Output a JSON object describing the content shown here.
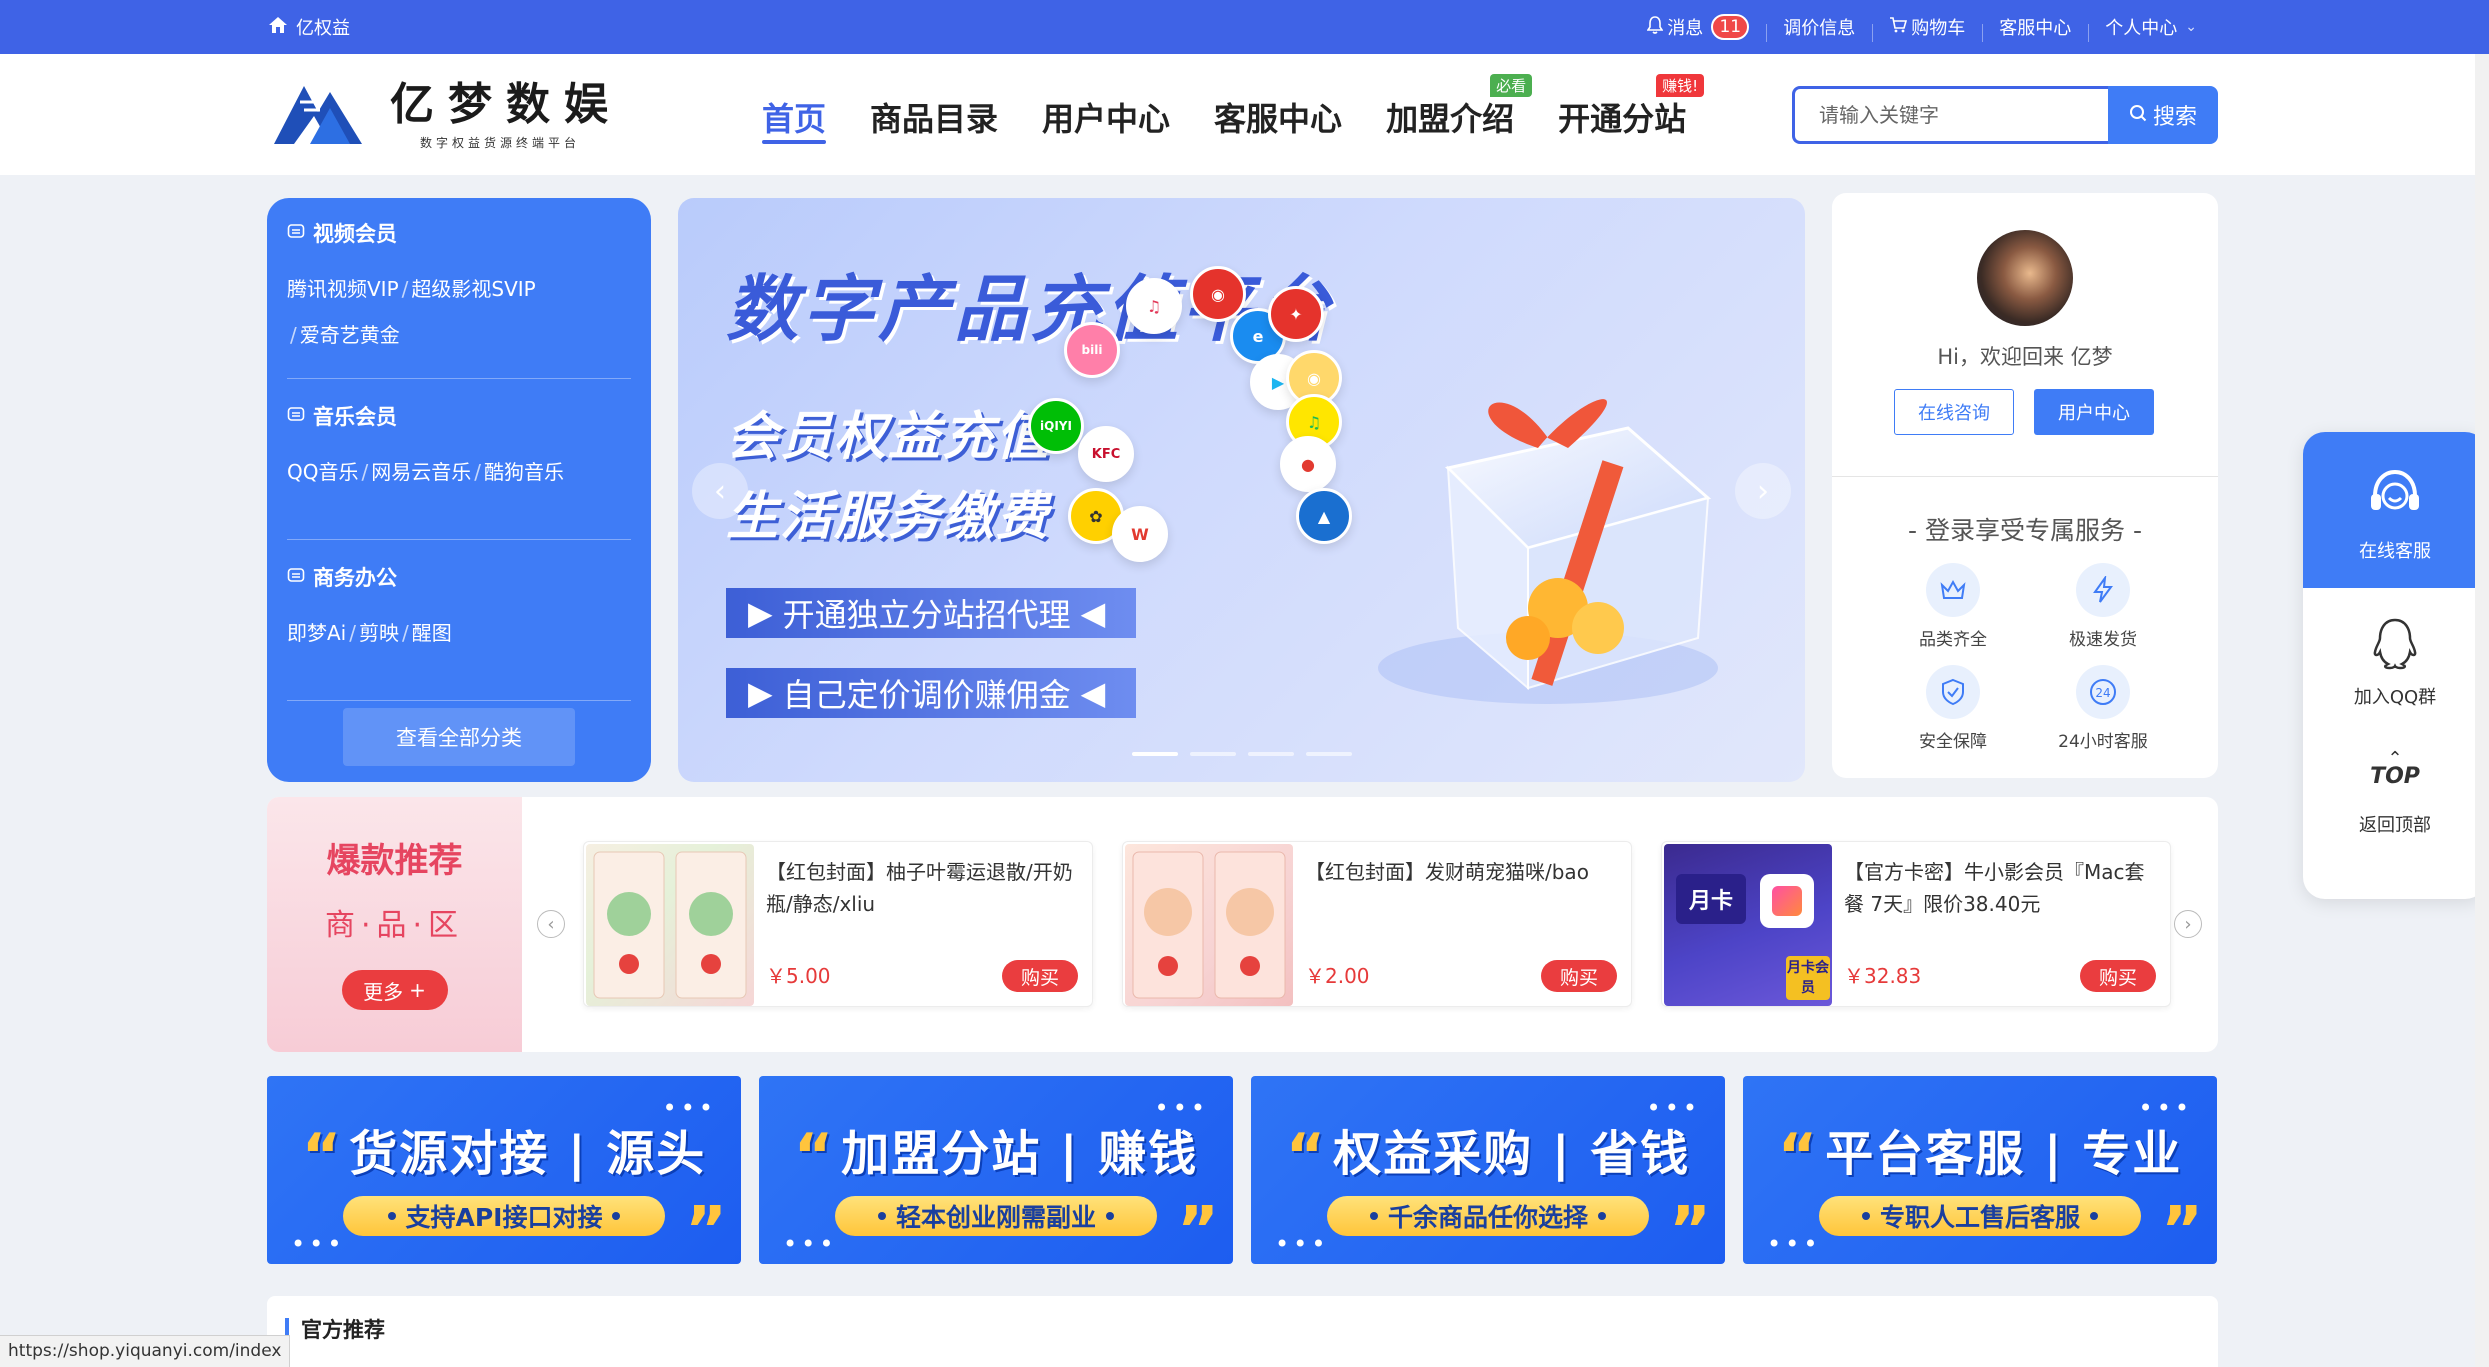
{
  "topbar": {
    "site_name": "亿权益",
    "messages_label": "消息",
    "messages_count": "11",
    "price_info": "调价信息",
    "cart": "购物车",
    "service": "客服中心",
    "personal": "个人中心"
  },
  "header": {
    "logo_name": "亿梦数娱",
    "logo_tagline": "数字权益货源终端平台",
    "nav": [
      {
        "label": "首页"
      },
      {
        "label": "商品目录"
      },
      {
        "label": "用户中心"
      },
      {
        "label": "客服中心"
      },
      {
        "label": "加盟介绍",
        "tag": "必看"
      },
      {
        "label": "开通分站",
        "tag": "赚钱!"
      }
    ],
    "search_placeholder": "请输入关键字",
    "search_button": "搜索"
  },
  "categories": {
    "blocks": [
      {
        "title": "视频会员",
        "links": [
          "腾讯视频VIP",
          "超级影视SVIP",
          "爱奇艺黄金"
        ]
      },
      {
        "title": "音乐会员",
        "links": [
          "QQ音乐",
          "网易云音乐",
          "酷狗音乐"
        ]
      },
      {
        "title": "商务办公",
        "links": [
          "即梦Ai",
          "剪映",
          "醒图"
        ]
      }
    ],
    "view_all": "查看全部分类"
  },
  "banner": {
    "title": "数字产品充值平台",
    "line1": "会员权益充值",
    "line2": "生活服务缴费",
    "pill1": "开通独立分站招代理",
    "pill2": "自己定价调价赚佣金",
    "slide_index": 1,
    "slide_count": 4,
    "icons": [
      "bilibili",
      "QQ音乐",
      "网易云",
      "饿了么",
      "腾讯视频",
      "爱奇艺",
      "KFC",
      "WPS",
      "优酷",
      "喜马拉雅",
      "美团",
      "QQ"
    ]
  },
  "user": {
    "greeting": "Hi，欢迎回来 亿梦",
    "consult_button": "在线咨询",
    "center_button": "用户中心",
    "services_title": "- 登录享受专属服务 -",
    "services": [
      {
        "label": "品类齐全",
        "icon": "crown-icon"
      },
      {
        "label": "极速发货",
        "icon": "lightning-icon"
      },
      {
        "label": "安全保障",
        "icon": "shield-icon"
      },
      {
        "label": "24小时客服",
        "icon": "clock-24-icon"
      }
    ]
  },
  "hot": {
    "title": "爆款推荐",
    "subtitle": "商·品·区",
    "more": "更多",
    "products": [
      {
        "title": "【红包封面】柚子叶霉运退散/开奶瓶/静态/xliu",
        "price": "￥5.00",
        "buy": "购买"
      },
      {
        "title": "【红包封面】发财萌宠猫咪/bao",
        "price": "￥2.00",
        "buy": "购买"
      },
      {
        "title": "【官方卡密】牛小影会员『Mac套餐 7天』限价38.40元",
        "price": "￥32.83",
        "buy": "购买",
        "thumb_label": "月卡",
        "thumb_badge": "月卡会员"
      }
    ]
  },
  "features": [
    {
      "title_a": "货源对接",
      "title_b": "源头",
      "slogan": "支持API接口对接"
    },
    {
      "title_a": "加盟分站",
      "title_b": "赚钱",
      "slogan": "轻本创业刚需副业"
    },
    {
      "title_a": "权益采购",
      "title_b": "省钱",
      "slogan": "千余商品任你选择"
    },
    {
      "title_a": "平台客服",
      "title_b": "专业",
      "slogan": "专职人工售后客服"
    }
  ],
  "official": {
    "title": "官方推荐"
  },
  "float": {
    "online_service": "在线客服",
    "qq_group": "加入QQ群",
    "top_label": "TOP",
    "back_top": "返回顶部"
  },
  "status_url": "https://shop.yiquanyi.com/index",
  "colors": {
    "primary": "#3f63e6",
    "accent_blue": "#3f7cf6",
    "red": "#ea3d3f",
    "yellow": "#ffc43d"
  }
}
